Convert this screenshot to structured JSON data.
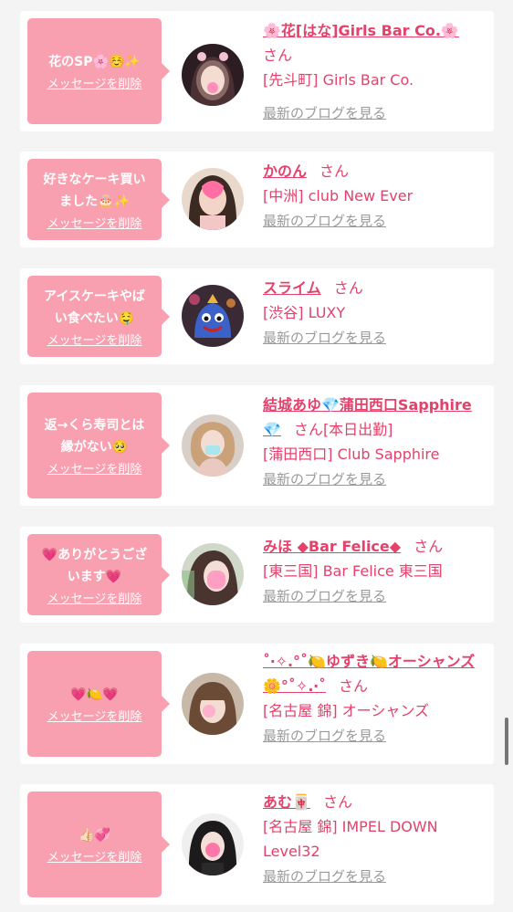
{
  "colors": {
    "accent": "#e4416b",
    "bubble": "#f9a0b0",
    "card": "#ffffff",
    "background": "#f4f4f4",
    "link_gray": "#9a9a9a"
  },
  "entries": [
    {
      "message": "花のSP🌸☺️✨",
      "delete_label": "メッセージを削除",
      "name": "🌸花[はな]Girls Bar Co.🌸",
      "honorific": "さん",
      "status": "",
      "shop": "[先斗町] Girls Bar Co.",
      "blog_link": "最新のブログを見る",
      "avatar_icon": "avatar-photo"
    },
    {
      "message": "好きなケーキ買い\nました🎂✨",
      "delete_label": "メッセージを削除",
      "name": "かのん",
      "honorific": "さん",
      "status": "",
      "shop": "[中洲] club New Ever",
      "blog_link": "最新のブログを見る",
      "avatar_icon": "avatar-photo"
    },
    {
      "message": "アイスケーキやば\nい食べたい🤤",
      "delete_label": "メッセージを削除",
      "name": "スライム",
      "honorific": "さん",
      "status": "",
      "shop": "[渋谷] LUXY",
      "blog_link": "最新のブログを見る",
      "avatar_icon": "avatar-photo"
    },
    {
      "message": "返→くら寿司とは\n縁がない🥺",
      "delete_label": "メッセージを削除",
      "name": "結城あゆ💎蒲田西口Sapphire💎",
      "honorific": "さん",
      "status": "[本日出勤]",
      "shop": "[蒲田西口] Club Sapphire",
      "blog_link": "最新のブログを見る",
      "avatar_icon": "avatar-photo"
    },
    {
      "message": "💗ありがとうござ\nいます💗",
      "delete_label": "メッセージを削除",
      "name": "みほ ◆Bar Felice◆",
      "honorific": "さん",
      "status": "",
      "shop": "[東三国] Bar Felice 東三国",
      "blog_link": "最新のブログを見る",
      "avatar_icon": "avatar-photo"
    },
    {
      "message": "💗🍋💗",
      "delete_label": "メッセージを削除",
      "name": "˚‧✧.°˚🍋ゆずき🍋オーシャンズ🌼°˚✧.‧˚",
      "honorific": "さん",
      "status": "",
      "shop": "[名古屋 錦] オーシャンズ",
      "blog_link": "最新のブログを見る",
      "avatar_icon": "avatar-photo"
    },
    {
      "message": "👍🏻💞",
      "delete_label": "メッセージを削除",
      "name": "あむ🀄",
      "honorific": "さん",
      "status": "",
      "shop": "[名古屋 錦] IMPEL DOWN Level32",
      "blog_link": "最新のブログを見る",
      "avatar_icon": "avatar-photo"
    }
  ]
}
